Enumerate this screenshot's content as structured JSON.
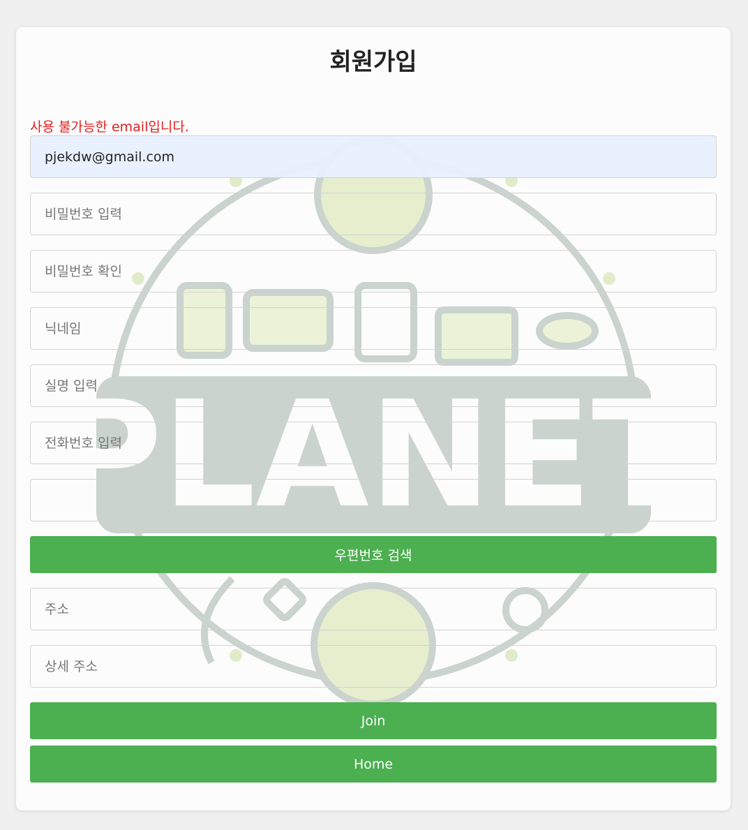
{
  "page": {
    "title": "회원가입",
    "error_message": "사용 불가능한 email입니다."
  },
  "form": {
    "email": {
      "value": "pjekdw@gmail.com"
    },
    "password": {
      "placeholder": "비밀번호 입력"
    },
    "password_confirm": {
      "placeholder": "비밀번호 확인"
    },
    "nickname": {
      "placeholder": "닉네임"
    },
    "real_name": {
      "placeholder": "실명 입력"
    },
    "phone": {
      "placeholder": "전화번호 입력"
    },
    "postcode": {
      "value": ""
    },
    "postcode_search_label": "우편번호 검색",
    "address": {
      "placeholder": "주소"
    },
    "address_detail": {
      "placeholder": "상세 주소"
    },
    "join_label": "Join",
    "home_label": "Home"
  },
  "watermark": {
    "text_large": "PLANET",
    "text_small": "PLANET"
  },
  "colors": {
    "accent": "#4caf50",
    "error": "#e02020",
    "autofill": "#e8f0fe"
  }
}
